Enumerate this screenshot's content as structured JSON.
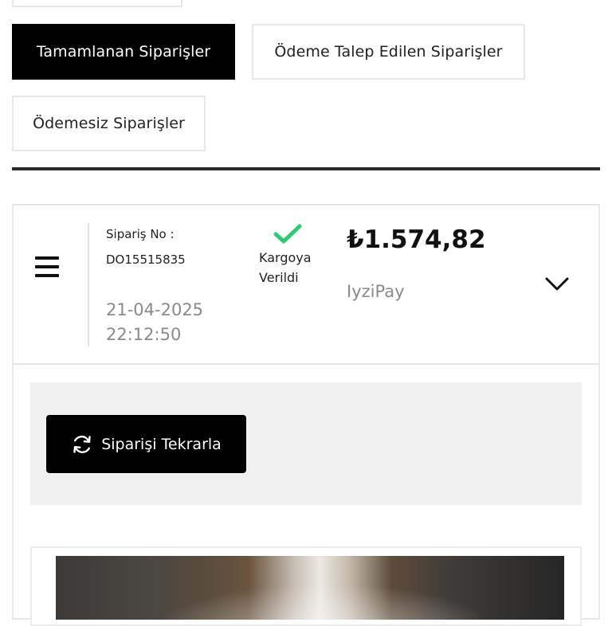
{
  "tabs": [
    {
      "label": "Tamamlanan Siparişler",
      "active": true
    },
    {
      "label": "Ödeme Talep Edilen Siparişler",
      "active": false
    },
    {
      "label": "Ödemesiz Siparişler",
      "active": false
    }
  ],
  "order": {
    "number_label": "Sipariş No :",
    "number": "DO15515835",
    "date": "21-04-2025",
    "time": "22:12:50",
    "status_line1": "Kargoya",
    "status_line2": "Verildi",
    "amount": "₺1.574,82",
    "payment_method": "IyziPay"
  },
  "actions": {
    "reorder_label": "Siparişi Tekrarla"
  },
  "icons": {
    "menu": "menu-icon",
    "status": "check-icon",
    "expand": "chevron-down-icon",
    "reorder": "refresh-icon"
  },
  "colors": {
    "primary": "#000000",
    "status_green": "#2ecc71",
    "muted_text": "#8a8a8a",
    "panel_gray": "#f1f1f1"
  }
}
